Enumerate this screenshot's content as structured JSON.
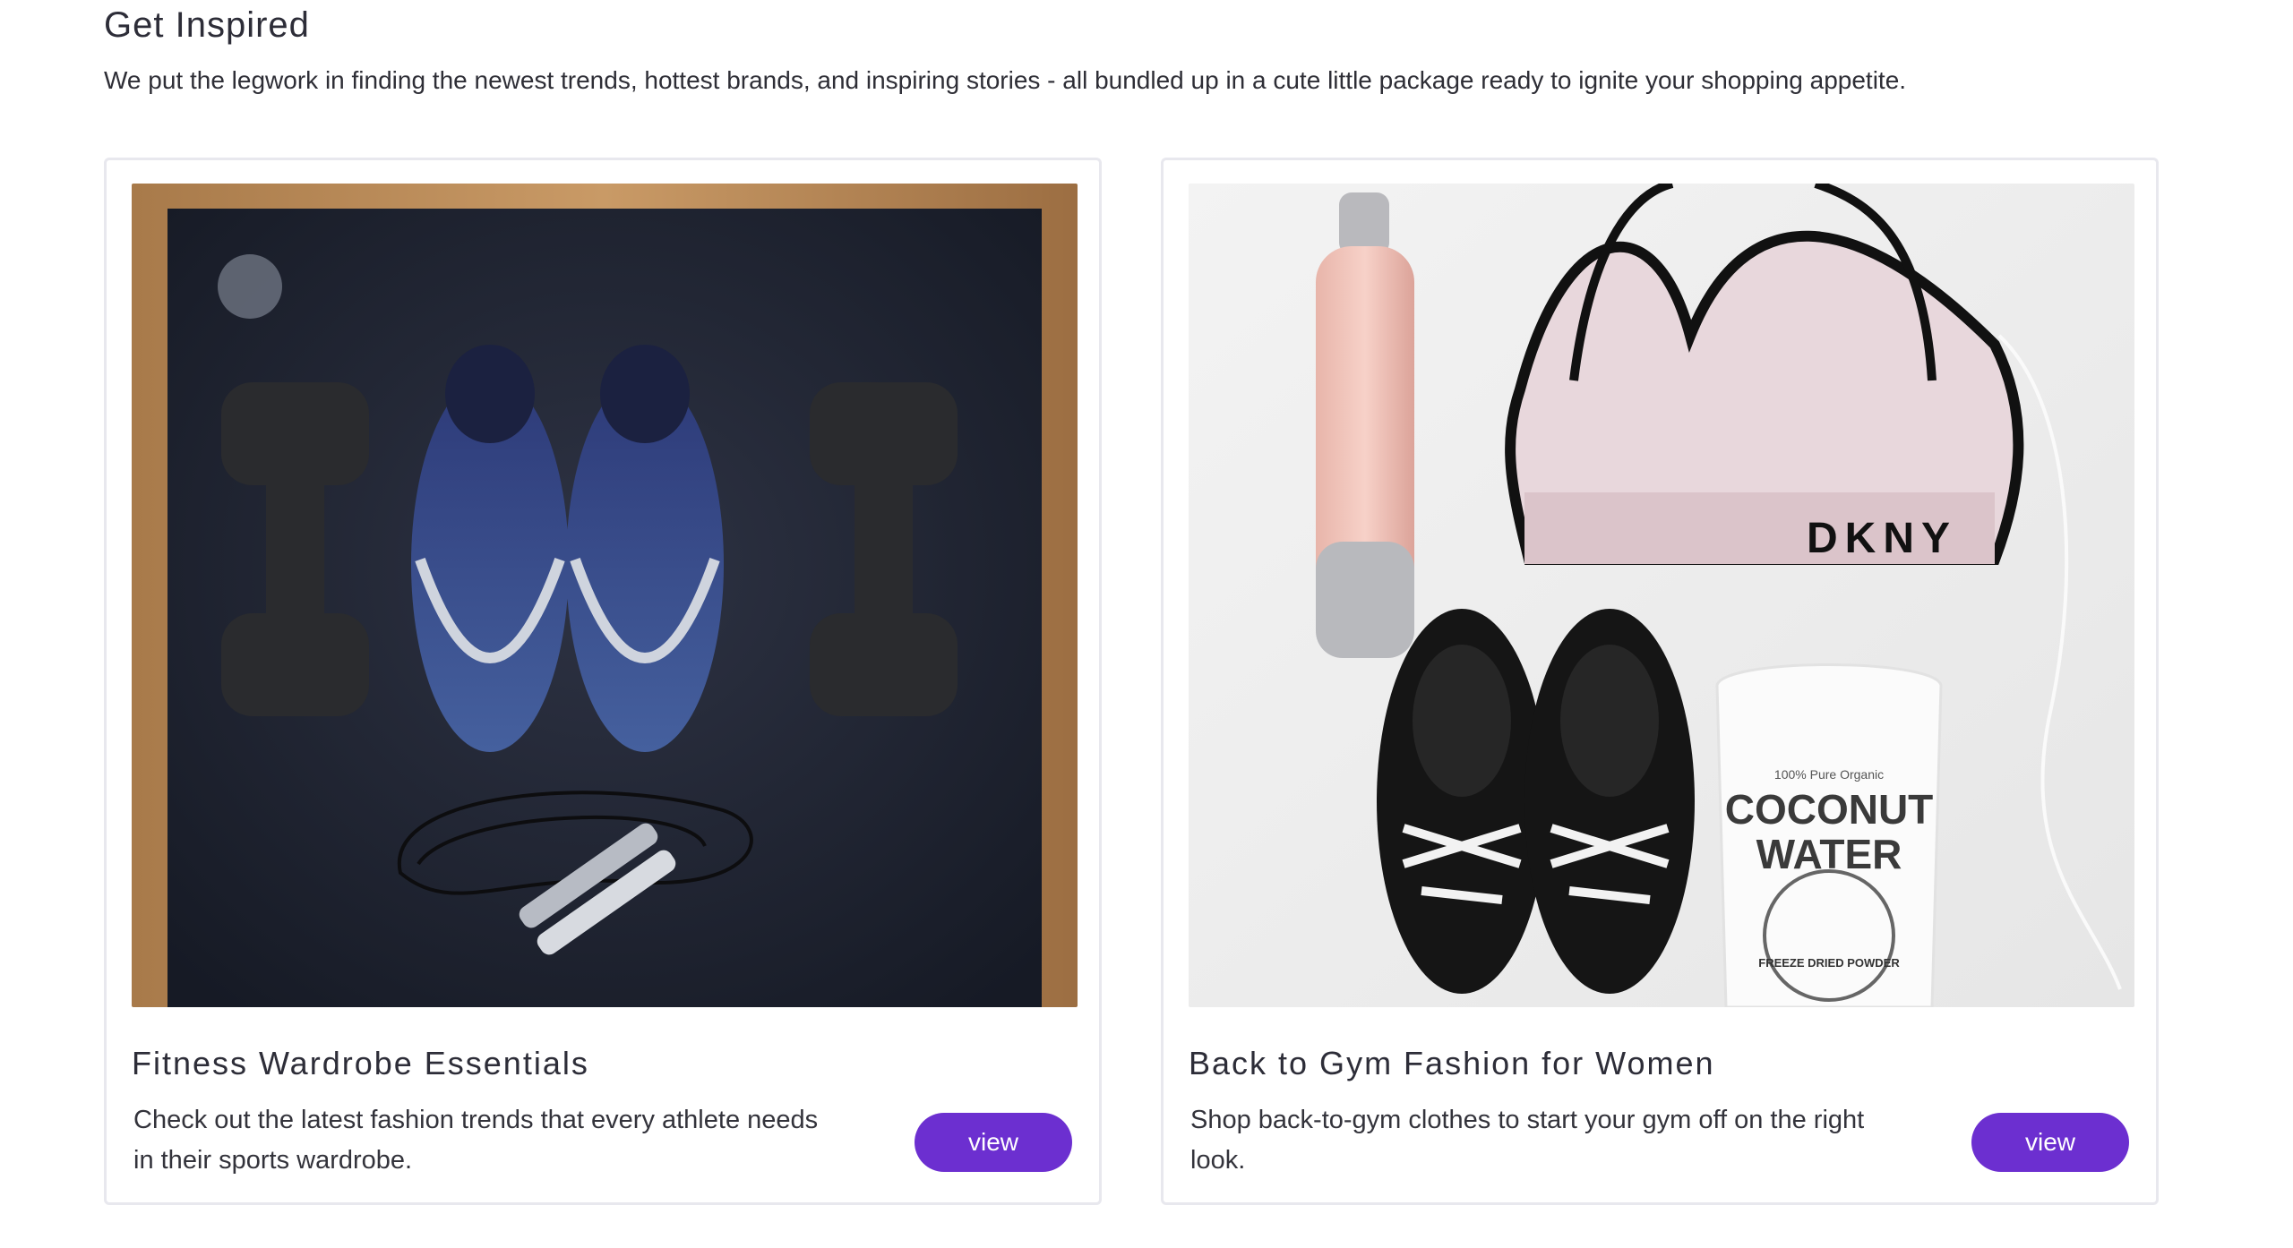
{
  "section": {
    "title": "Get Inspired",
    "subtitle": "We put the legwork in finding the newest trends, hottest brands, and inspiring stories - all bundled up in a cute little package ready to ignite your shopping appetite."
  },
  "cards": [
    {
      "title": "Fitness Wardrobe Essentials",
      "description": "Check out the latest fashion trends that every athlete needs in their sports wardrobe.",
      "button_label": "view",
      "image_subject": "dumbbells, blue sneakers and jump rope on a yoga mat"
    },
    {
      "title": "Back to Gym Fashion for Women",
      "description": "Shop back-to-gym clothes to start your gym off on the right look.",
      "button_label": "view",
      "image_subject": "pink water bottle, sports bra, black sneakers and coconut water pouch",
      "image_text": {
        "bra_brand": "DKNY",
        "pouch_top": "100% Pure Organic",
        "pouch_line1": "COCONUT",
        "pouch_line2": "WATER",
        "pouch_bottom": "FREEZE DRIED POWDER"
      }
    }
  ],
  "colors": {
    "accent": "#6c2fd0",
    "border": "#e8e8ee",
    "text": "#2d2d38"
  }
}
